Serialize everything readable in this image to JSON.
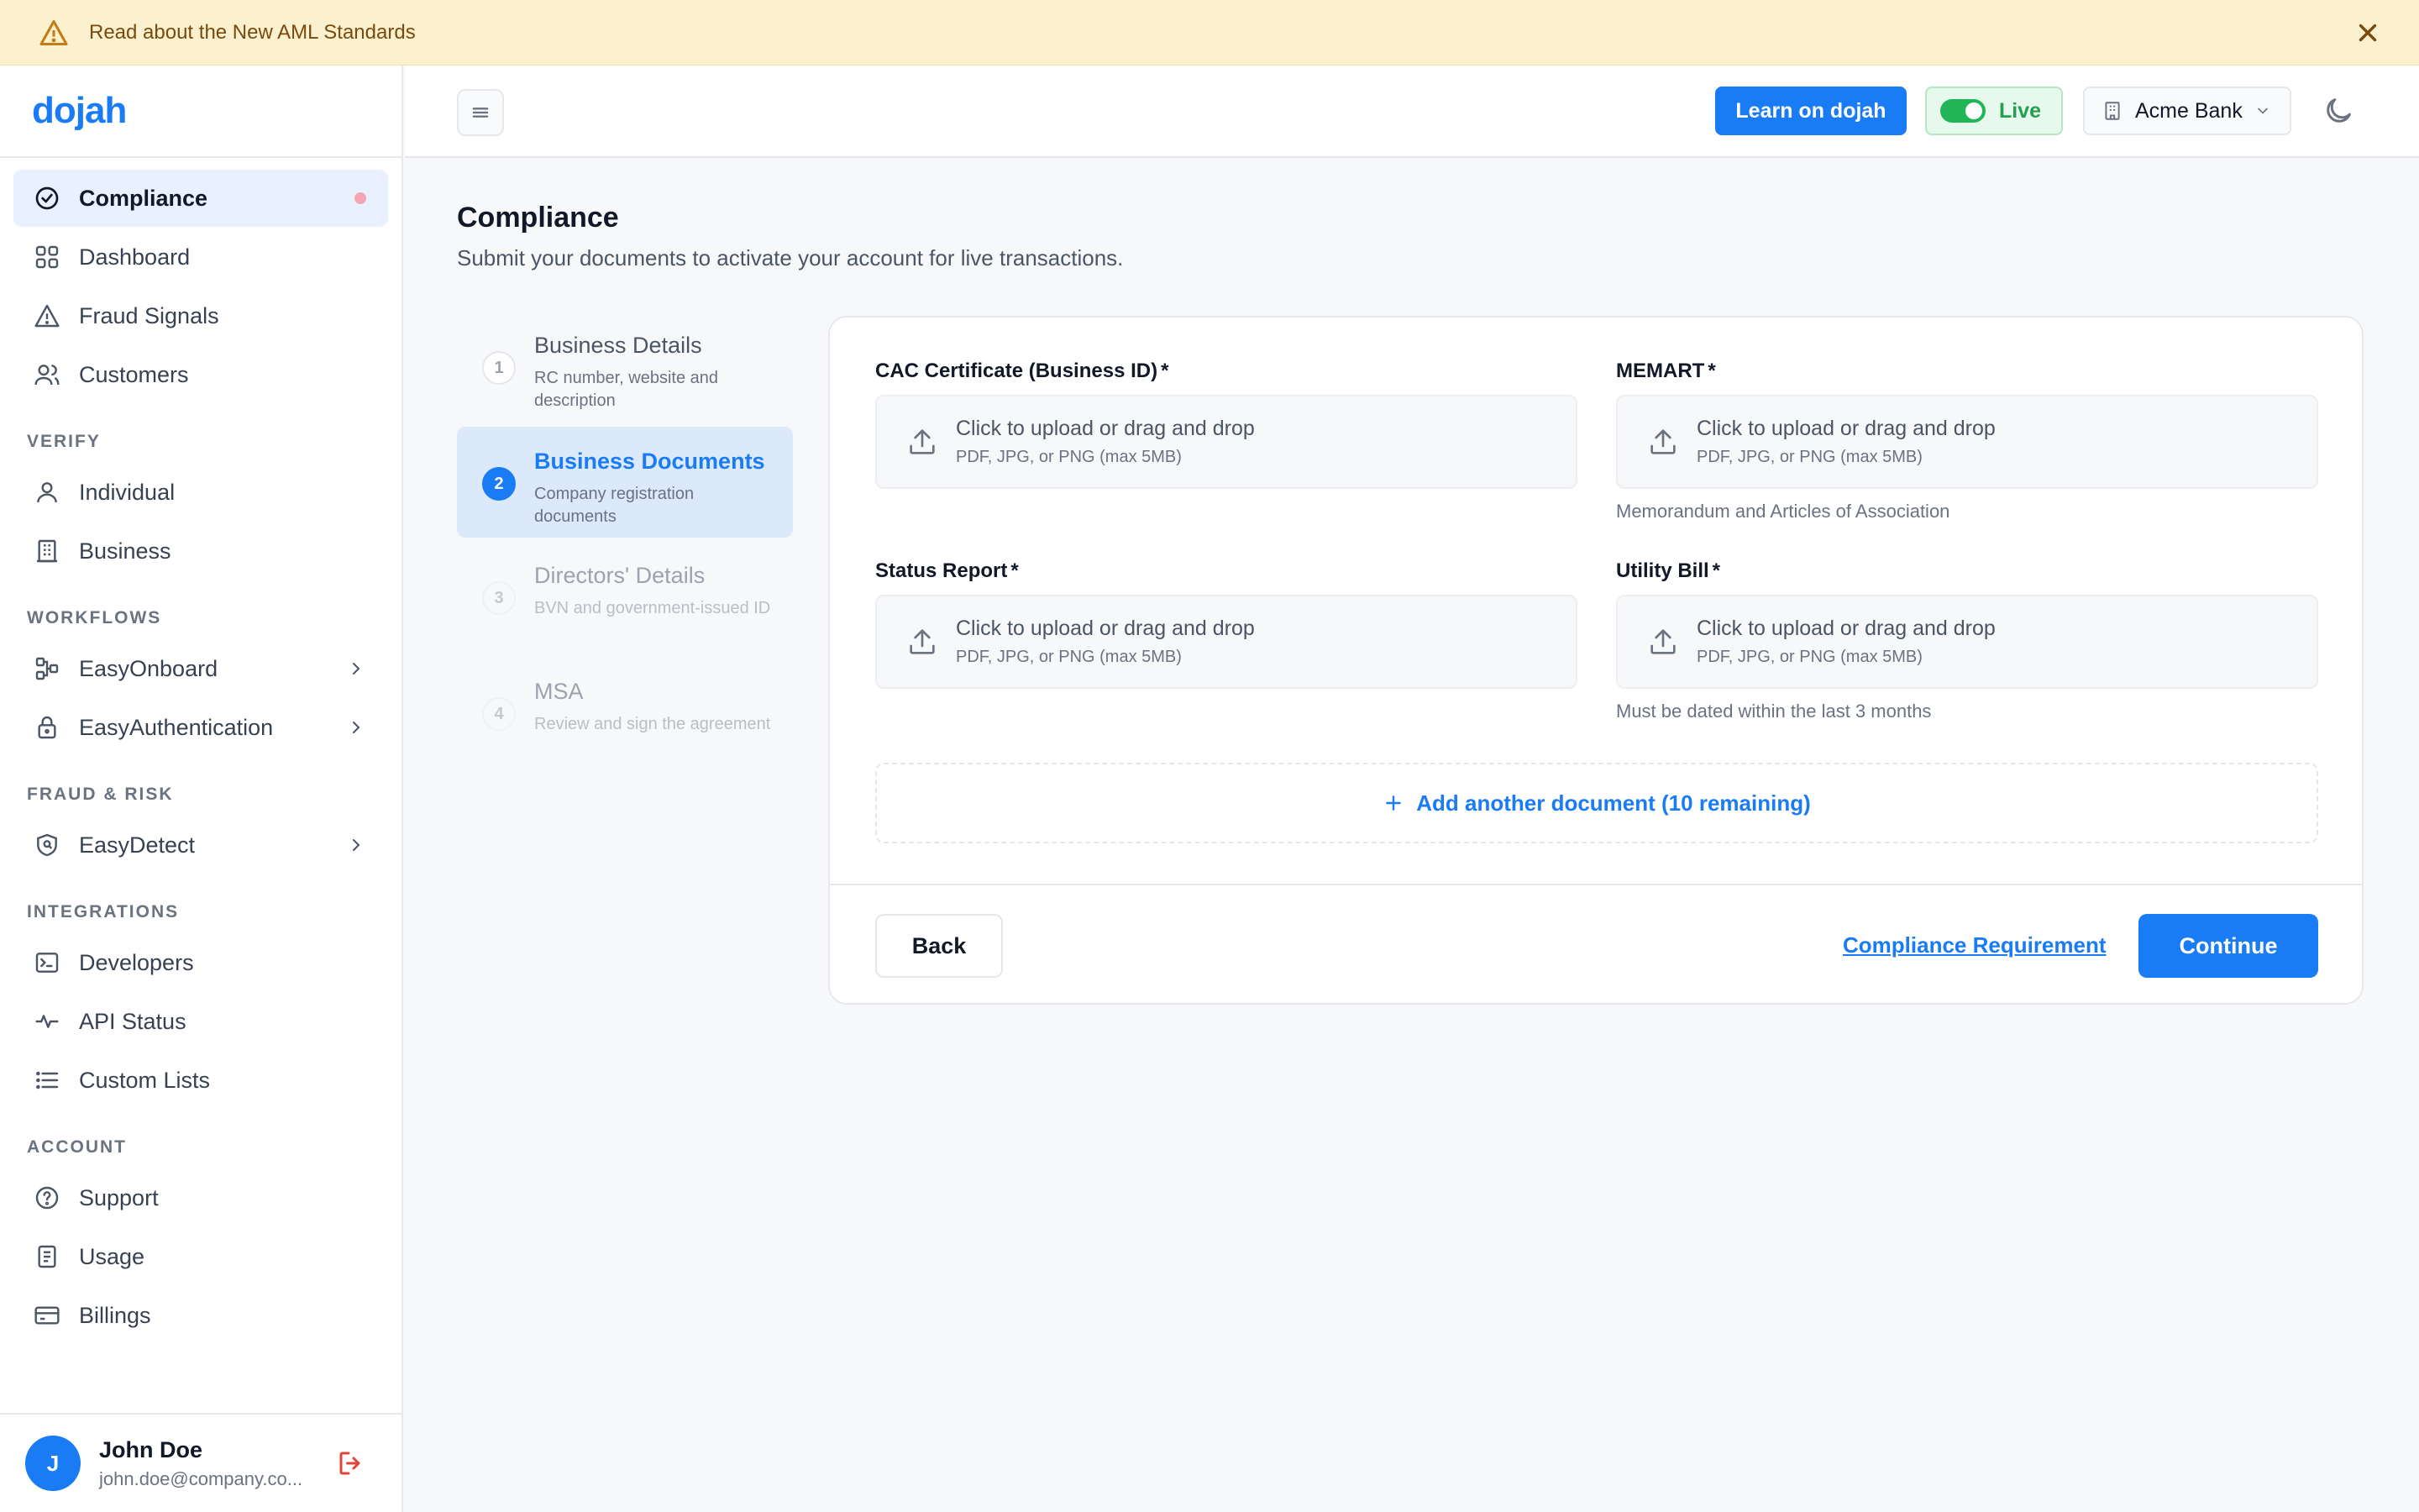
{
  "banner": {
    "text": "Read about the New AML Standards"
  },
  "brand": {
    "logo": "dojah",
    "accent": "#1a7cf5"
  },
  "sidebar": {
    "items": [
      {
        "label": "Compliance",
        "icon": "check-circle-icon",
        "active": true
      },
      {
        "label": "Dashboard",
        "icon": "grid-icon"
      },
      {
        "label": "Fraud Signals",
        "icon": "warning-icon"
      },
      {
        "label": "Customers",
        "icon": "users-icon"
      }
    ],
    "sections": [
      {
        "title": "VERIFY",
        "items": [
          {
            "label": "Individual",
            "icon": "person-icon"
          },
          {
            "label": "Business",
            "icon": "building-icon"
          }
        ]
      },
      {
        "title": "WORKFLOWS",
        "items": [
          {
            "label": "EasyOnboard",
            "icon": "flow-icon"
          },
          {
            "label": "EasyAuthentication",
            "icon": "lock-icon"
          }
        ]
      },
      {
        "title": "FRAUD & RISK",
        "items": [
          {
            "label": "EasyDetect",
            "icon": "shield-icon"
          }
        ]
      },
      {
        "title": "INTEGRATIONS",
        "items": [
          {
            "label": "Developers",
            "icon": "terminal-icon"
          },
          {
            "label": "API Status",
            "icon": "pulse-icon"
          },
          {
            "label": "Custom Lists",
            "icon": "list-icon"
          }
        ]
      },
      {
        "title": "ACCOUNT",
        "items": [
          {
            "label": "Support",
            "icon": "help-icon"
          },
          {
            "label": "Usage",
            "icon": "document-icon"
          },
          {
            "label": "Billings",
            "icon": "card-icon"
          }
        ]
      }
    ]
  },
  "user": {
    "initial": "J",
    "name": "John Doe",
    "email": "john.doe@company.co..."
  },
  "header": {
    "learn_label": "Learn on dojah",
    "live_label": "Live",
    "org_label": "Acme Bank"
  },
  "main": {
    "title": "Compliance",
    "subtitle": "Submit your documents to activate your account for live transactions."
  },
  "steps": [
    {
      "num": "1",
      "title": "Business Details",
      "desc": "RC number, website and description"
    },
    {
      "num": "2",
      "title": "Business Documents",
      "desc": "Company registration documents"
    },
    {
      "num": "3",
      "title": "Directors' Details",
      "desc": "BVN and government-issued ID"
    },
    {
      "num": "4",
      "title": "MSA",
      "desc": "Review and sign the agreement"
    }
  ],
  "upload": {
    "drop_text": "Click to upload or drag and drop",
    "drop_sub": "PDF, JPG, or PNG (max 5MB)",
    "required_mark": "*",
    "fields": [
      {
        "label": "CAC Certificate (Business ID)",
        "hint": ""
      },
      {
        "label": "MEMART",
        "hint": "Memorandum and Articles of Association"
      },
      {
        "label": "Status Report",
        "hint": ""
      },
      {
        "label": "Utility Bill",
        "hint": "Must be dated within the last 3 months"
      }
    ]
  },
  "actions": {
    "add_label": "Add another document (10 remaining)",
    "back_label": "Back",
    "requirement_label": "Compliance Requirement",
    "continue_label": "Continue"
  }
}
